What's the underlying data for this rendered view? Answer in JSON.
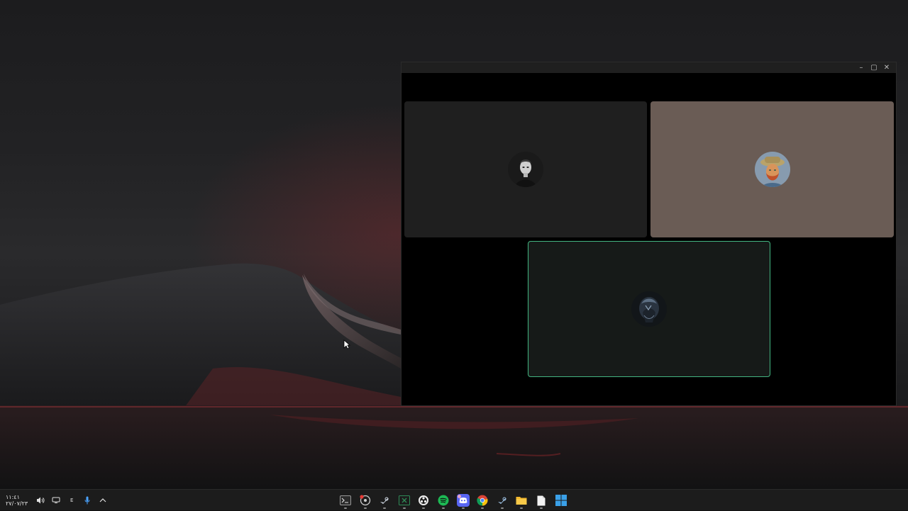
{
  "taskbar": {
    "clock_time": "١١:٤١",
    "clock_date": "٢٧/٠٧/٢٣",
    "language_indicator": "E",
    "apps": [
      {
        "name": "terminal-app-icon",
        "running": true
      },
      {
        "name": "recording-app-icon",
        "running": true
      },
      {
        "name": "steam-app-icon",
        "running": true
      },
      {
        "name": "excel-app-icon",
        "running": true
      },
      {
        "name": "obs-app-icon",
        "running": true
      },
      {
        "name": "spotify-app-icon",
        "running": true
      },
      {
        "name": "discord-app-icon",
        "running": true
      },
      {
        "name": "chrome-app-icon",
        "running": true
      },
      {
        "name": "steam-alt-app-icon",
        "running": true
      },
      {
        "name": "file-explorer-app-icon",
        "running": true
      },
      {
        "name": "notepad-app-icon",
        "running": true
      },
      {
        "name": "start-button-icon",
        "running": false
      }
    ]
  },
  "call_window": {
    "controls": {
      "minimize": "–",
      "maximize": "▢",
      "close": "✕"
    },
    "participants": [
      {
        "name": "participant-1",
        "avatar": "bw-portrait-avatar",
        "speaking": false
      },
      {
        "name": "participant-2",
        "avatar": "van-gogh-avatar",
        "speaking": false
      },
      {
        "name": "participant-3",
        "avatar": "dark-figure-avatar",
        "speaking": true
      }
    ]
  },
  "colors": {
    "speaking_border": "#43b581",
    "taskbar_bg": "#1c1c1c",
    "tile_dark": "#1f1f1f",
    "tile_taupe": "#6a5c55"
  }
}
